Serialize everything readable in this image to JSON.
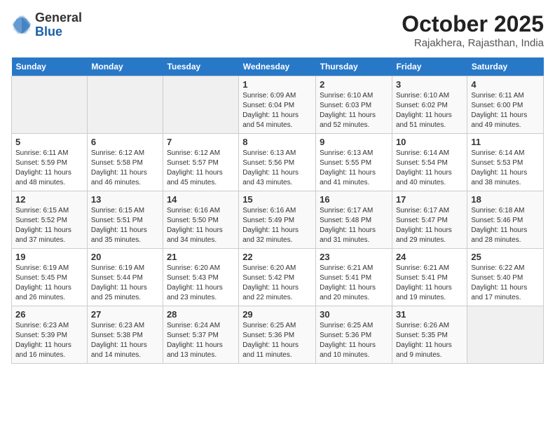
{
  "logo": {
    "general": "General",
    "blue": "Blue"
  },
  "header": {
    "month": "October 2025",
    "location": "Rajakhera, Rajasthan, India"
  },
  "weekdays": [
    "Sunday",
    "Monday",
    "Tuesday",
    "Wednesday",
    "Thursday",
    "Friday",
    "Saturday"
  ],
  "weeks": [
    [
      {
        "day": "",
        "info": ""
      },
      {
        "day": "",
        "info": ""
      },
      {
        "day": "",
        "info": ""
      },
      {
        "day": "1",
        "info": "Sunrise: 6:09 AM\nSunset: 6:04 PM\nDaylight: 11 hours\nand 54 minutes."
      },
      {
        "day": "2",
        "info": "Sunrise: 6:10 AM\nSunset: 6:03 PM\nDaylight: 11 hours\nand 52 minutes."
      },
      {
        "day": "3",
        "info": "Sunrise: 6:10 AM\nSunset: 6:02 PM\nDaylight: 11 hours\nand 51 minutes."
      },
      {
        "day": "4",
        "info": "Sunrise: 6:11 AM\nSunset: 6:00 PM\nDaylight: 11 hours\nand 49 minutes."
      }
    ],
    [
      {
        "day": "5",
        "info": "Sunrise: 6:11 AM\nSunset: 5:59 PM\nDaylight: 11 hours\nand 48 minutes."
      },
      {
        "day": "6",
        "info": "Sunrise: 6:12 AM\nSunset: 5:58 PM\nDaylight: 11 hours\nand 46 minutes."
      },
      {
        "day": "7",
        "info": "Sunrise: 6:12 AM\nSunset: 5:57 PM\nDaylight: 11 hours\nand 45 minutes."
      },
      {
        "day": "8",
        "info": "Sunrise: 6:13 AM\nSunset: 5:56 PM\nDaylight: 11 hours\nand 43 minutes."
      },
      {
        "day": "9",
        "info": "Sunrise: 6:13 AM\nSunset: 5:55 PM\nDaylight: 11 hours\nand 41 minutes."
      },
      {
        "day": "10",
        "info": "Sunrise: 6:14 AM\nSunset: 5:54 PM\nDaylight: 11 hours\nand 40 minutes."
      },
      {
        "day": "11",
        "info": "Sunrise: 6:14 AM\nSunset: 5:53 PM\nDaylight: 11 hours\nand 38 minutes."
      }
    ],
    [
      {
        "day": "12",
        "info": "Sunrise: 6:15 AM\nSunset: 5:52 PM\nDaylight: 11 hours\nand 37 minutes."
      },
      {
        "day": "13",
        "info": "Sunrise: 6:15 AM\nSunset: 5:51 PM\nDaylight: 11 hours\nand 35 minutes."
      },
      {
        "day": "14",
        "info": "Sunrise: 6:16 AM\nSunset: 5:50 PM\nDaylight: 11 hours\nand 34 minutes."
      },
      {
        "day": "15",
        "info": "Sunrise: 6:16 AM\nSunset: 5:49 PM\nDaylight: 11 hours\nand 32 minutes."
      },
      {
        "day": "16",
        "info": "Sunrise: 6:17 AM\nSunset: 5:48 PM\nDaylight: 11 hours\nand 31 minutes."
      },
      {
        "day": "17",
        "info": "Sunrise: 6:17 AM\nSunset: 5:47 PM\nDaylight: 11 hours\nand 29 minutes."
      },
      {
        "day": "18",
        "info": "Sunrise: 6:18 AM\nSunset: 5:46 PM\nDaylight: 11 hours\nand 28 minutes."
      }
    ],
    [
      {
        "day": "19",
        "info": "Sunrise: 6:19 AM\nSunset: 5:45 PM\nDaylight: 11 hours\nand 26 minutes."
      },
      {
        "day": "20",
        "info": "Sunrise: 6:19 AM\nSunset: 5:44 PM\nDaylight: 11 hours\nand 25 minutes."
      },
      {
        "day": "21",
        "info": "Sunrise: 6:20 AM\nSunset: 5:43 PM\nDaylight: 11 hours\nand 23 minutes."
      },
      {
        "day": "22",
        "info": "Sunrise: 6:20 AM\nSunset: 5:42 PM\nDaylight: 11 hours\nand 22 minutes."
      },
      {
        "day": "23",
        "info": "Sunrise: 6:21 AM\nSunset: 5:41 PM\nDaylight: 11 hours\nand 20 minutes."
      },
      {
        "day": "24",
        "info": "Sunrise: 6:21 AM\nSunset: 5:41 PM\nDaylight: 11 hours\nand 19 minutes."
      },
      {
        "day": "25",
        "info": "Sunrise: 6:22 AM\nSunset: 5:40 PM\nDaylight: 11 hours\nand 17 minutes."
      }
    ],
    [
      {
        "day": "26",
        "info": "Sunrise: 6:23 AM\nSunset: 5:39 PM\nDaylight: 11 hours\nand 16 minutes."
      },
      {
        "day": "27",
        "info": "Sunrise: 6:23 AM\nSunset: 5:38 PM\nDaylight: 11 hours\nand 14 minutes."
      },
      {
        "day": "28",
        "info": "Sunrise: 6:24 AM\nSunset: 5:37 PM\nDaylight: 11 hours\nand 13 minutes."
      },
      {
        "day": "29",
        "info": "Sunrise: 6:25 AM\nSunset: 5:36 PM\nDaylight: 11 hours\nand 11 minutes."
      },
      {
        "day": "30",
        "info": "Sunrise: 6:25 AM\nSunset: 5:36 PM\nDaylight: 11 hours\nand 10 minutes."
      },
      {
        "day": "31",
        "info": "Sunrise: 6:26 AM\nSunset: 5:35 PM\nDaylight: 11 hours\nand 9 minutes."
      },
      {
        "day": "",
        "info": ""
      }
    ]
  ]
}
